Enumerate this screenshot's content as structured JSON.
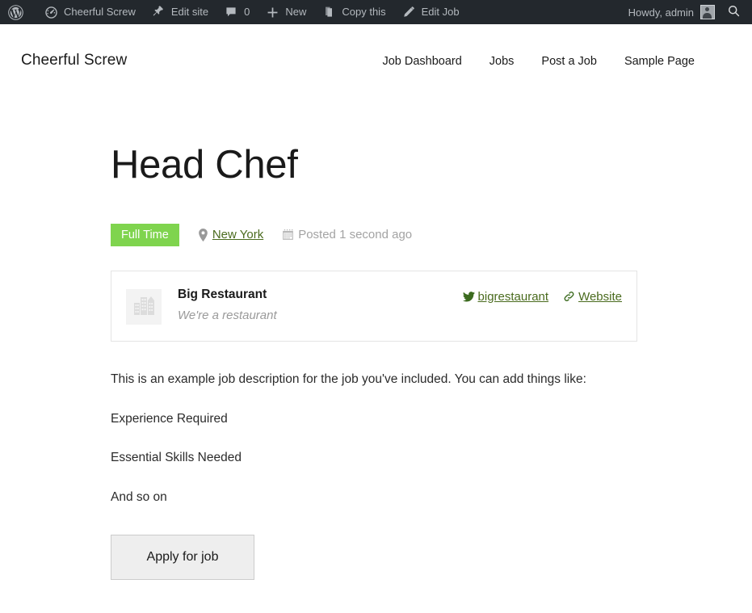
{
  "adminbar": {
    "items": [
      {
        "icon": "wordpress-logo-icon",
        "label": ""
      },
      {
        "icon": "dashboard-gauge-icon",
        "label": "Cheerful Screw"
      },
      {
        "icon": "pin-icon",
        "label": "Edit site"
      },
      {
        "icon": "comment-bubble-icon",
        "label": "0"
      },
      {
        "icon": "plus-icon",
        "label": "New"
      },
      {
        "icon": "copy-pages-icon",
        "label": "Copy this"
      },
      {
        "icon": "pencil-icon",
        "label": "Edit Job"
      }
    ],
    "howdy": "Howdy, admin",
    "avatar_icon": "user-avatar-icon",
    "search_icon": "search-icon",
    "background": "#23282d",
    "text_color": "#b4b9be"
  },
  "header": {
    "site_title": "Cheerful Screw",
    "nav": [
      {
        "label": "Job Dashboard"
      },
      {
        "label": "Jobs"
      },
      {
        "label": "Post a Job"
      },
      {
        "label": "Sample Page"
      }
    ]
  },
  "job": {
    "title": "Head Chef",
    "type": "Full Time",
    "type_color": "#7fd44e",
    "location": "New York",
    "location_icon": "map-pin-icon",
    "posted": "Posted 1 second ago",
    "posted_icon": "calendar-icon",
    "link_color": "#4a6b1e"
  },
  "company": {
    "logo_icon": "building-placeholder-icon",
    "name": "Big Restaurant",
    "tagline": "We're a restaurant",
    "twitter": {
      "icon": "twitter-bird-icon",
      "label": "bigrestaurant"
    },
    "website": {
      "icon": "chain-link-icon",
      "label": "Website"
    }
  },
  "description": {
    "paragraphs": [
      "This is an example job description for the job you've included. You can add things like:",
      "Experience Required",
      "Essential Skills Needed",
      "And so on"
    ]
  },
  "apply": {
    "label": "Apply for job"
  }
}
